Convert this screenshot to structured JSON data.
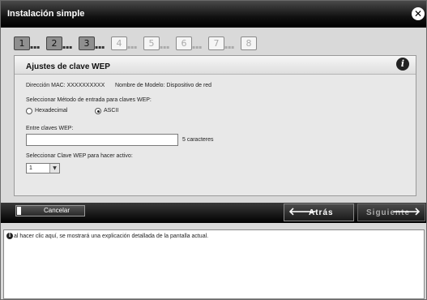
{
  "window": {
    "title": "Instalación simple",
    "close_symbol": "✕"
  },
  "steps": [
    {
      "number": "1",
      "state": "done"
    },
    {
      "number": "2",
      "state": "done"
    },
    {
      "number": "3",
      "state": "done"
    },
    {
      "number": "4",
      "state": "pending"
    },
    {
      "number": "5",
      "state": "pending"
    },
    {
      "number": "6",
      "state": "pending"
    },
    {
      "number": "7",
      "state": "pending"
    },
    {
      "number": "8",
      "state": "pending"
    }
  ],
  "step_dots": "▪▪▪",
  "panel": {
    "title": "Ajustes de clave WEP",
    "info_icon": "info-icon",
    "info_glyph": "i",
    "mac_label": "Dirección MAC: XXXXXXXXXX",
    "model_label": "Nombre de Modelo: Dispositivo de red",
    "method_label": "Seleccionar Método de entrada para claves WEP:",
    "method_options": [
      "Hexadecimal",
      "ASCII"
    ],
    "method_selected": "ASCII",
    "key_label": "Entre claves WEP:",
    "key_value": "",
    "key_hint": "5 caracteres",
    "active_label": "Seleccionar Clave WEP para hacer activo:",
    "active_value": "1"
  },
  "buttons": {
    "cancel": "Cancelar",
    "back": "Atrás",
    "next": "Siguiente"
  },
  "help": {
    "icon": "info-icon",
    "text": "al hacer clic aquí, se mostrará una explicación detallada de la pantalla actual."
  }
}
